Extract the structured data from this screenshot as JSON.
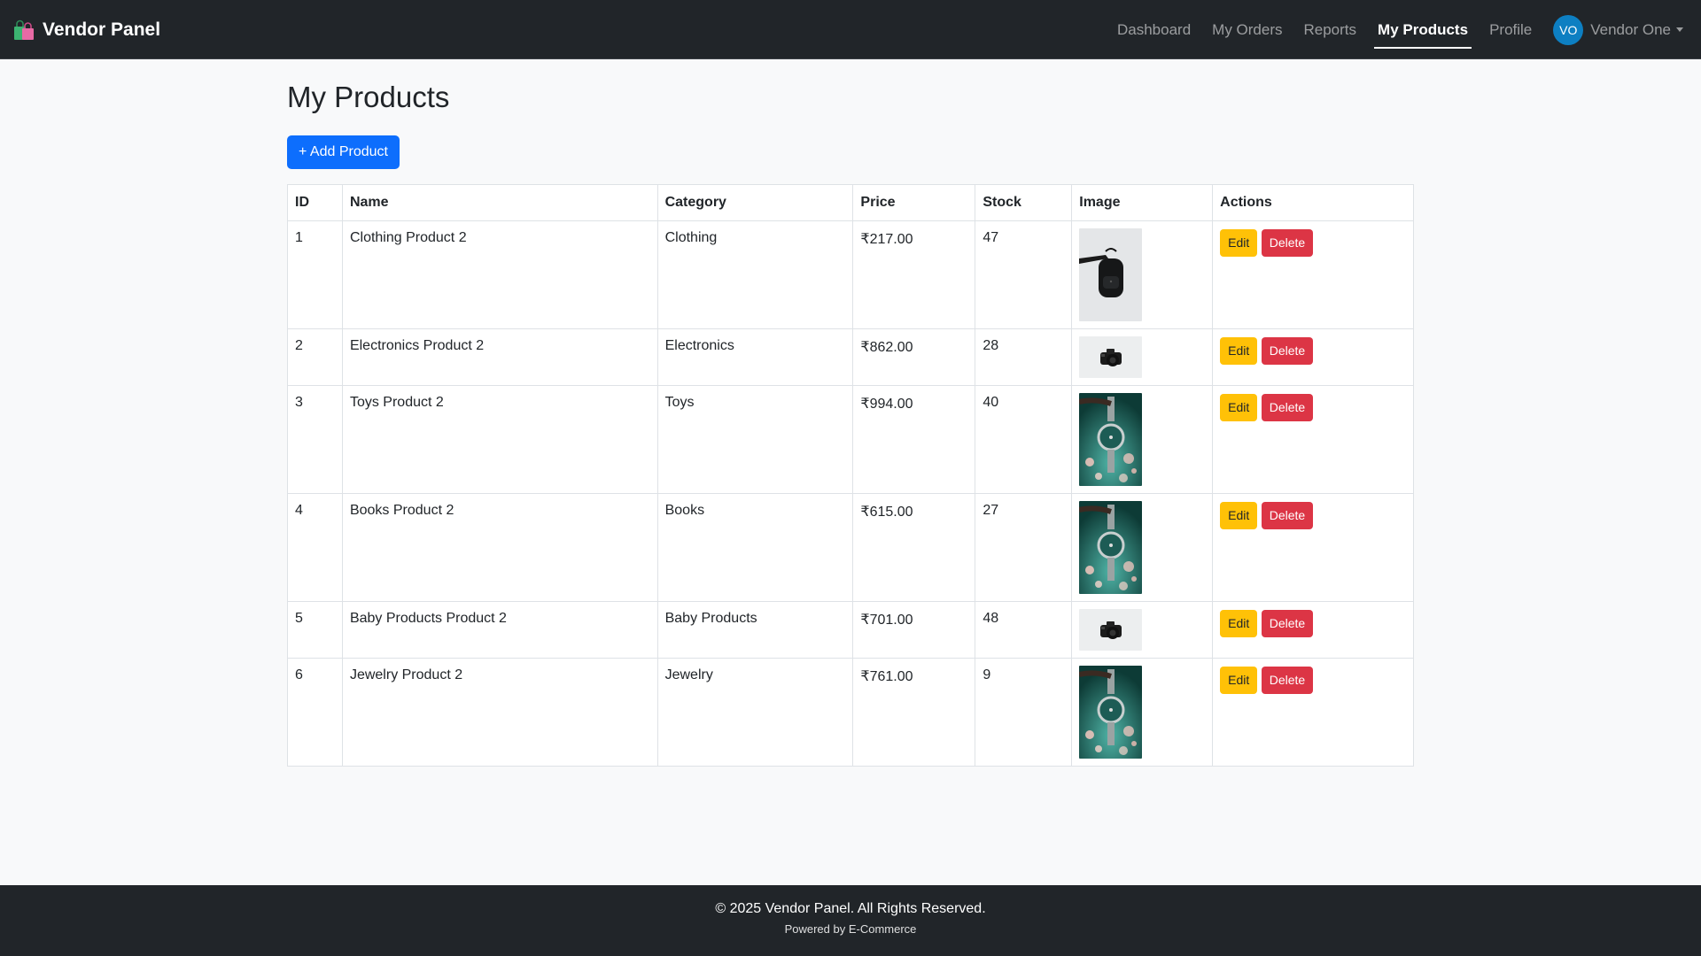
{
  "navbar": {
    "brand": "Vendor Panel",
    "brand_icon": "shopping-bags-icon",
    "links": [
      {
        "label": "Dashboard",
        "active": false
      },
      {
        "label": "My Orders",
        "active": false
      },
      {
        "label": "Reports",
        "active": false
      },
      {
        "label": "My Products",
        "active": true
      },
      {
        "label": "Profile",
        "active": false
      }
    ],
    "user": {
      "initials": "VO",
      "name": "Vendor One",
      "avatar_color": "#0d7fc2"
    }
  },
  "page": {
    "title": "My Products",
    "add_button": "+ Add Product"
  },
  "table": {
    "headers": [
      "ID",
      "Name",
      "Category",
      "Price",
      "Stock",
      "Image",
      "Actions"
    ],
    "rows": [
      {
        "id": "1",
        "name": "Clothing Product 2",
        "category": "Clothing",
        "price": "₹217.00",
        "stock": "47",
        "image": "backpack",
        "edit": "Edit",
        "delete": "Delete"
      },
      {
        "id": "2",
        "name": "Electronics Product 2",
        "category": "Electronics",
        "price": "₹862.00",
        "stock": "28",
        "image": "camera",
        "edit": "Edit",
        "delete": "Delete"
      },
      {
        "id": "3",
        "name": "Toys Product 2",
        "category": "Toys",
        "price": "₹994.00",
        "stock": "40",
        "image": "watch",
        "edit": "Edit",
        "delete": "Delete"
      },
      {
        "id": "4",
        "name": "Books Product 2",
        "category": "Books",
        "price": "₹615.00",
        "stock": "27",
        "image": "watch",
        "edit": "Edit",
        "delete": "Delete"
      },
      {
        "id": "5",
        "name": "Baby Products Product 2",
        "category": "Baby Products",
        "price": "₹701.00",
        "stock": "48",
        "image": "camera",
        "edit": "Edit",
        "delete": "Delete"
      },
      {
        "id": "6",
        "name": "Jewelry Product 2",
        "category": "Jewelry",
        "price": "₹761.00",
        "stock": "9",
        "image": "watch",
        "edit": "Edit",
        "delete": "Delete"
      }
    ]
  },
  "footer": {
    "copyright": "© 2025 Vendor Panel. All Rights Reserved.",
    "powered": "Powered by E-Commerce"
  },
  "colors": {
    "navbar_bg": "#212529",
    "primary": "#0d6efd",
    "warning": "#ffc107",
    "danger": "#dc3545"
  }
}
